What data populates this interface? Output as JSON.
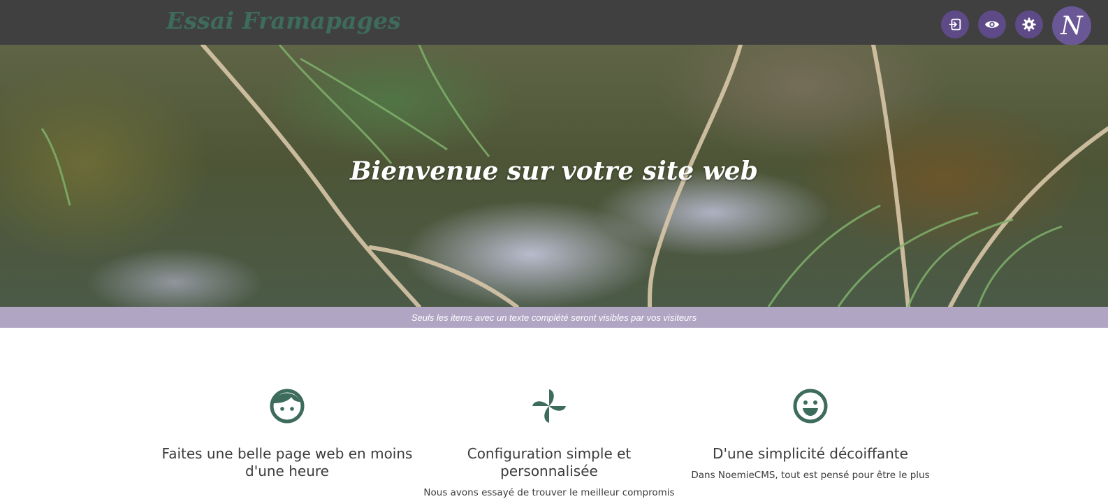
{
  "topbar": {
    "site_title": "Essai Framapages",
    "logo_letter": "N",
    "buttons": [
      {
        "name": "login",
        "icon": "login-icon"
      },
      {
        "name": "preview",
        "icon": "eye-icon"
      },
      {
        "name": "settings",
        "icon": "gear-icon"
      }
    ],
    "help_icon": "question-icon"
  },
  "hero": {
    "title": "Bienvenue sur votre site web"
  },
  "notice": {
    "text": "Seuls les items avec un texte complété seront visibles par vos visiteurs"
  },
  "features": [
    {
      "icon": "child-face-icon",
      "title": "Faites une belle page web en moins d'une heure",
      "text": ""
    },
    {
      "icon": "pinwheel-icon",
      "title": "Configuration simple et personnalisée",
      "text": "Nous avons essayé de trouver le meilleur compromis"
    },
    {
      "icon": "smiley-icon",
      "title": "D'une simplicité décoiffante",
      "text": "Dans NoemieCMS, tout est pensé pour être le plus"
    }
  ],
  "colors": {
    "topbar": "#404040",
    "brand": "#3d6b5c",
    "button": "#5e4a86",
    "help": "#c9911d",
    "notice": "#b0a6c4",
    "icon": "#3d6b5c"
  }
}
